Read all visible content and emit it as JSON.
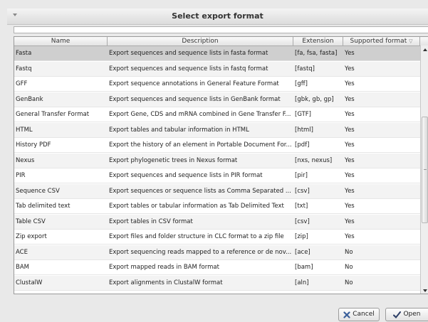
{
  "window": {
    "title": "Select export format"
  },
  "search": {
    "value": ""
  },
  "table": {
    "columns": [
      "Name",
      "Description",
      "Extension",
      "Supported format"
    ],
    "sort_indicator": "▽",
    "rows": [
      {
        "name": "Fasta",
        "description": "Export sequences and sequence lists in fasta format",
        "extension": "[fa, fsa, fasta]",
        "supported": "Yes"
      },
      {
        "name": "Fastq",
        "description": "Export sequences and sequence lists in fastq format",
        "extension": "[fastq]",
        "supported": "Yes"
      },
      {
        "name": "GFF",
        "description": "Export sequence annotations in General Feature Format",
        "extension": "[gff]",
        "supported": "Yes"
      },
      {
        "name": "GenBank",
        "description": "Export sequences and sequence lists in GenBank format",
        "extension": "[gbk, gb, gp]",
        "supported": "Yes"
      },
      {
        "name": "General Transfer Format",
        "description": "Export Gene, CDS and mRNA combined in Gene Transfer F...",
        "extension": "[GTF]",
        "supported": "Yes"
      },
      {
        "name": "HTML",
        "description": "Export tables and tabular information in HTML",
        "extension": "[html]",
        "supported": "Yes"
      },
      {
        "name": "History PDF",
        "description": "Export the history of an element in Portable Document For...",
        "extension": "[pdf]",
        "supported": "Yes"
      },
      {
        "name": "Nexus",
        "description": "Export phylogenetic trees in Nexus format",
        "extension": "[nxs, nexus]",
        "supported": "Yes"
      },
      {
        "name": "PIR",
        "description": "Export sequences and sequence lists in PIR format",
        "extension": "[pir]",
        "supported": "Yes"
      },
      {
        "name": "Sequence CSV",
        "description": "Export sequences or sequence lists as Comma Separated ...",
        "extension": "[csv]",
        "supported": "Yes"
      },
      {
        "name": "Tab delimited text",
        "description": "Export tables or tabular information as Tab Delimited Text",
        "extension": "[txt]",
        "supported": "Yes"
      },
      {
        "name": "Table CSV",
        "description": "Export tables in CSV format",
        "extension": "[csv]",
        "supported": "Yes"
      },
      {
        "name": "Zip export",
        "description": "Export files and folder structure in CLC format to a zip file",
        "extension": "[zip]",
        "supported": "Yes"
      },
      {
        "name": "ACE",
        "description": "Export sequencing reads mapped to a reference or de nov...",
        "extension": "[ace]",
        "supported": "No"
      },
      {
        "name": "BAM",
        "description": "Export mapped reads in BAM format",
        "extension": "[bam]",
        "supported": "No"
      },
      {
        "name": "ClustalW",
        "description": "Export alignments in ClustalW format",
        "extension": "[aln]",
        "supported": "No"
      }
    ]
  },
  "buttons": {
    "cancel": "Cancel",
    "open": "Open"
  },
  "icons": {
    "cancel": "x-icon",
    "open": "checkmark-icon",
    "menu": "window-menu-icon"
  }
}
